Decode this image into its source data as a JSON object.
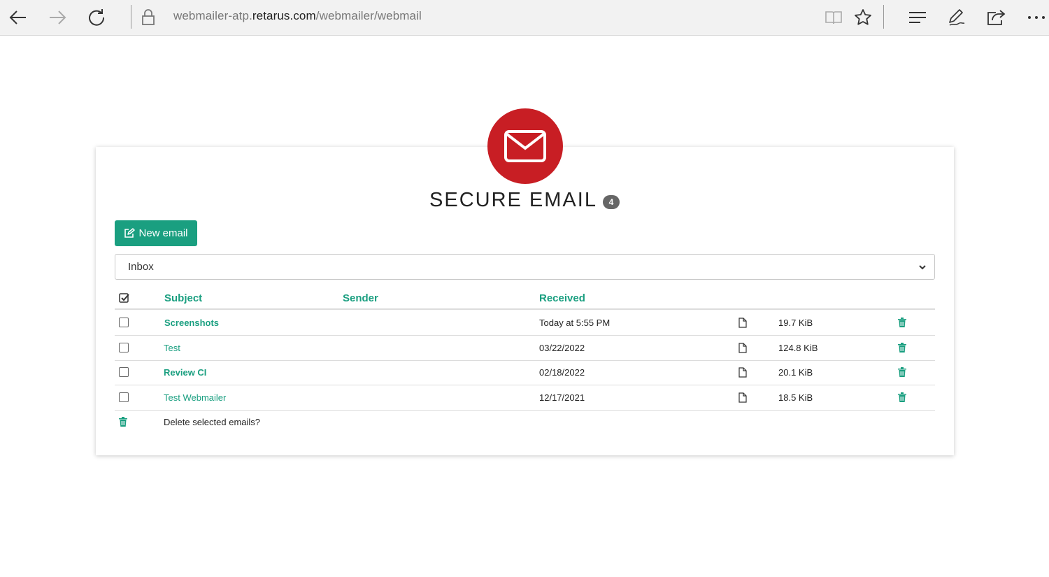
{
  "browser": {
    "url_prefix": "webmailer-atp.",
    "url_host": "retarus.com",
    "url_path": "/webmailer/webmail"
  },
  "app": {
    "title": "SECURE EMAIL",
    "unread_count": "4",
    "brand_color": "#c81e24",
    "accent_color": "#1a9f80"
  },
  "toolbar": {
    "new_email_label": "New email"
  },
  "folder": {
    "selected": "Inbox"
  },
  "table": {
    "headers": {
      "subject": "Subject",
      "sender": "Sender",
      "received": "Received"
    },
    "rows": [
      {
        "subject": "Screenshots",
        "sender": "",
        "received": "Today at 5:55 PM",
        "size": "19.7 KiB",
        "unread": true
      },
      {
        "subject": "Test",
        "sender": "",
        "received": "03/22/2022",
        "size": "124.8 KiB",
        "unread": false
      },
      {
        "subject": "Review CI",
        "sender": "",
        "received": "02/18/2022",
        "size": "20.1 KiB",
        "unread": true
      },
      {
        "subject": "Test Webmailer",
        "sender": "",
        "received": "12/17/2021",
        "size": "18.5 KiB",
        "unread": false
      }
    ],
    "delete_selected_label": "Delete selected emails?"
  }
}
